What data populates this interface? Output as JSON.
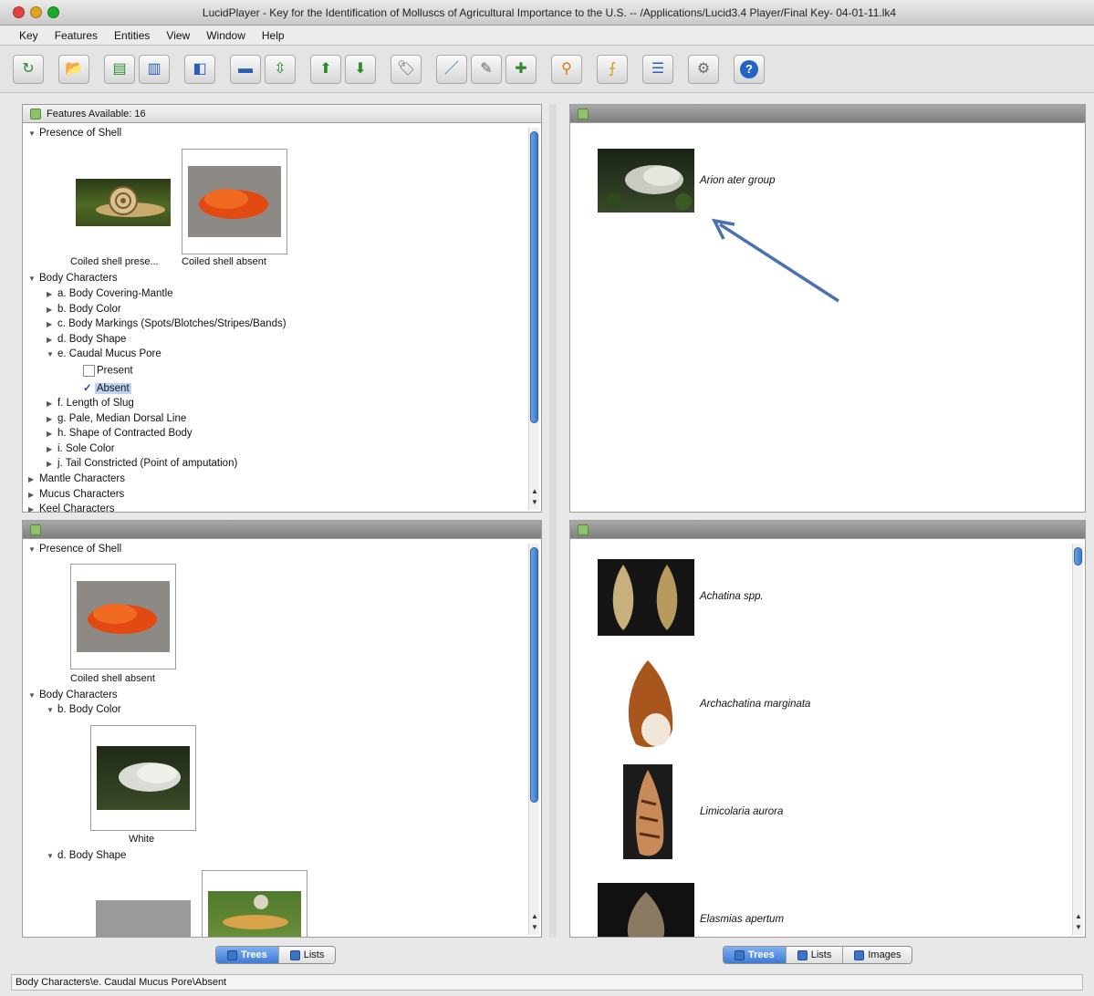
{
  "window": {
    "title": "LucidPlayer - Key for the Identification of Molluscs of Agricultural Importance to the U.S. -- /Applications/Lucid3.4 Player/Final Key- 04-01-11.lk4"
  },
  "menu": [
    "Key",
    "Features",
    "Entities",
    "View",
    "Window",
    "Help"
  ],
  "toolbar": {
    "buttons": [
      {
        "name": "restart-key-button",
        "icon": "↻"
      },
      {
        "name": "open-key-button",
        "icon": "📂"
      },
      {
        "name": "best-feature-button",
        "icon": "▤"
      },
      {
        "name": "prune-redundants-button",
        "icon": "▥"
      },
      {
        "name": "differences-button",
        "icon": "◧"
      },
      {
        "name": "view-features-button",
        "icon": "▬"
      },
      {
        "name": "view-entities-button",
        "icon": "⇳"
      },
      {
        "name": "promote-entities-button",
        "icon": "⬆"
      },
      {
        "name": "demote-entities-button",
        "icon": "⬇"
      },
      {
        "name": "tag-button",
        "icon": "🏷"
      },
      {
        "name": "edit-button",
        "icon": "／"
      },
      {
        "name": "tools-button",
        "icon": "✎"
      },
      {
        "name": "add-button",
        "icon": "✚"
      },
      {
        "name": "filter-button",
        "icon": "⚲"
      },
      {
        "name": "score-button",
        "icon": "⨍"
      },
      {
        "name": "list-button",
        "icon": "☰"
      },
      {
        "name": "settings-button",
        "icon": "⚙"
      },
      {
        "name": "help-button",
        "icon": "?"
      }
    ]
  },
  "features_available": {
    "header": "Features Available: 16",
    "presence_of_shell": "Presence of Shell",
    "state_1": "Coiled shell prese...",
    "state_2": "Coiled shell absent",
    "body_characters": "Body Characters",
    "items": [
      "a. Body Covering-Mantle",
      "b. Body Color",
      "c. Body Markings (Spots/Blotches/Stripes/Bands)",
      "d. Body Shape",
      "e. Caudal Mucus Pore"
    ],
    "pore_present": "Present",
    "pore_absent": "Absent",
    "items_after": [
      "f. Length of Slug",
      "g. Pale, Median Dorsal Line",
      "h. Shape of Contracted Body",
      "i. Sole Color",
      "j. Tail Constricted (Point of amputation)"
    ],
    "more": [
      "Mantle Characters",
      "Mucus Characters",
      "Keel Characters"
    ]
  },
  "features_chosen": {
    "presence_of_shell": "Presence of Shell",
    "state": "Coiled shell absent",
    "body_characters": "Body Characters",
    "body_color": "b. Body Color",
    "white": "White",
    "body_shape": "d. Body Shape"
  },
  "entities_remaining": {
    "items": [
      "Arion ater group"
    ]
  },
  "entities_discarded": {
    "items": [
      "Achatina spp.",
      "Archachatina marginata",
      "Limicolaria aurora",
      "Elasmias apertum"
    ]
  },
  "tabs_left": [
    "Trees",
    "Lists"
  ],
  "tabs_right": [
    "Trees",
    "Lists",
    "Images"
  ],
  "status": "Body Characters\\e. Caudal Mucus Pore\\Absent",
  "colors": {
    "accent": "#3e7bd6",
    "arrow": "#4a72ae"
  }
}
